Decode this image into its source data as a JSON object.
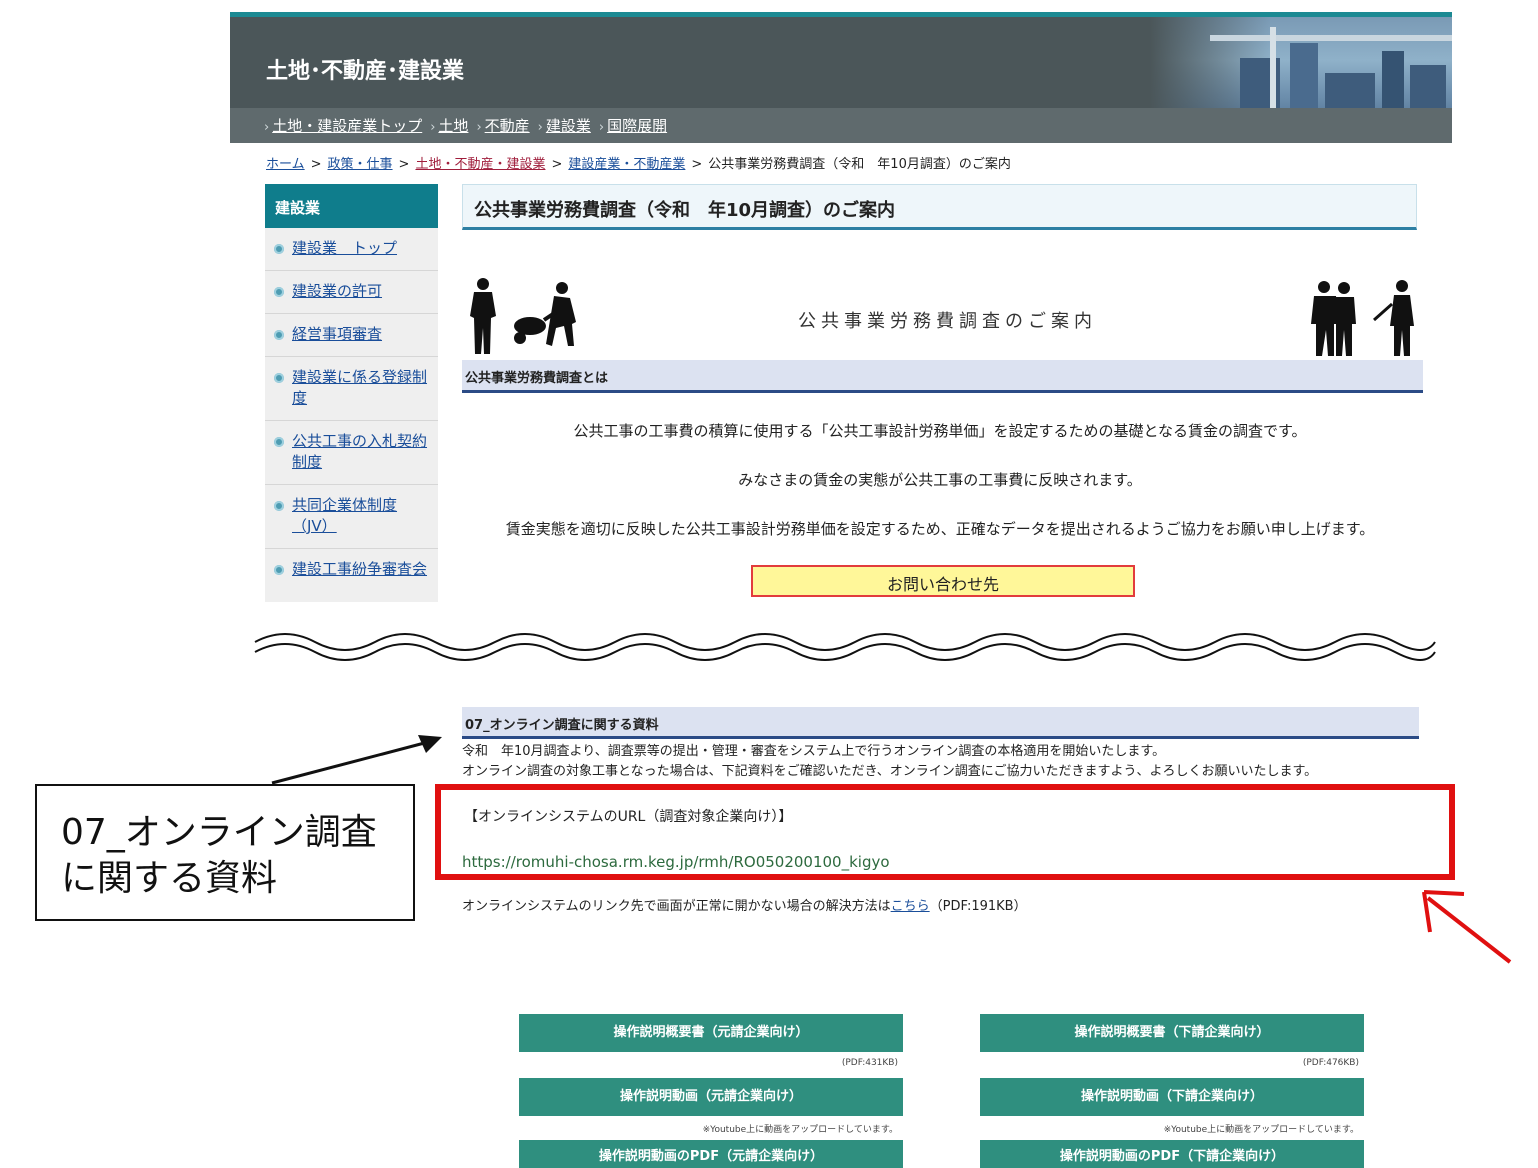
{
  "header": {
    "site_title": "土地･不動産･建設業"
  },
  "nav": {
    "items": [
      "土地・建設産業トップ",
      "土地",
      "不動産",
      "建設業",
      "国際展開"
    ]
  },
  "breadcrumb": {
    "items": [
      "ホーム",
      "政策・仕事",
      "土地・不動産・建設業",
      "建設産業・不動産業",
      "公共事業労務費調査（令和　年10月調査）のご案内"
    ],
    "separator": ">"
  },
  "sidebar": {
    "heading": "建設業",
    "items": [
      "建設業　トップ",
      "建設業の許可",
      "経営事項審査",
      "建設業に係る登録制度",
      "公共工事の入札契約制度",
      "共同企業体制度（JV）",
      "建設工事紛争審査会"
    ]
  },
  "main": {
    "page_title": "公共事業労務費調査（令和　年10月調査）のご案内",
    "banner_text": "公共事業労務費調査のご案内",
    "section1_heading": "公共事業労務費調査とは",
    "para1": "公共工事の工事費の積算に使用する「公共工事設計労務単価」を設定するための基礎となる賃金の調査です。",
    "para2": "みなさまの賃金の実態が公共工事の工事費に反映されます。",
    "para3": "賃金実態を適切に反映した公共工事設計労務単価を設定するため、正確なデータを提出されるようご協力をお願い申し上げます。",
    "contact_button": "お問い合わせ先",
    "section7_heading": "07_オンライン調査に関する資料",
    "section7_line1": "令和　年10月調査より、調査票等の提出・管理・審査をシステム上で行うオンライン調査の本格適用を開始いたします。",
    "section7_line2": "オンライン調査の対象工事となった場合は、下記資料をご確認いただき、オンライン調査にご協力いただきますよう、よろしくお願いいたします。",
    "url_label": "【オンラインシステムのURL（調査対象企業向け）】",
    "url": "https://romuhi-chosa.rm.keg.jp/rmh/RO050200100_kigyo",
    "trouble_prefix": "オンラインシステムのリンク先で画面が正常に開かない場合の解決方法は",
    "trouble_link": "こちら",
    "trouble_suffix": "（PDF:191KB）"
  },
  "callout": {
    "line1": "07_オンライン調査",
    "line2": "に関する資料"
  },
  "buttons": {
    "left": [
      {
        "label": "操作説明概要書（元請企業向け）",
        "note": "(PDF:431KB)"
      },
      {
        "label": "操作説明動画（元請企業向け）",
        "note": "※Youtube上に動画をアップロードしています。"
      },
      {
        "label": "操作説明動画のPDF（元請企業向け）",
        "note": ""
      }
    ],
    "right": [
      {
        "label": "操作説明概要書（下請企業向け）",
        "note": "(PDF:476KB)"
      },
      {
        "label": "操作説明動画（下請企業向け）",
        "note": "※Youtube上に動画をアップロードしています。"
      },
      {
        "label": "操作説明動画のPDF（下請企業向け）",
        "note": ""
      }
    ]
  },
  "colors": {
    "header_bg": "#4b5659",
    "sidebar_head": "#0f7d8c",
    "section_bar": "#dce2f1",
    "highlight_red": "#e01010",
    "button_green": "#2f8f7f",
    "contact_yellow": "#fff799"
  }
}
